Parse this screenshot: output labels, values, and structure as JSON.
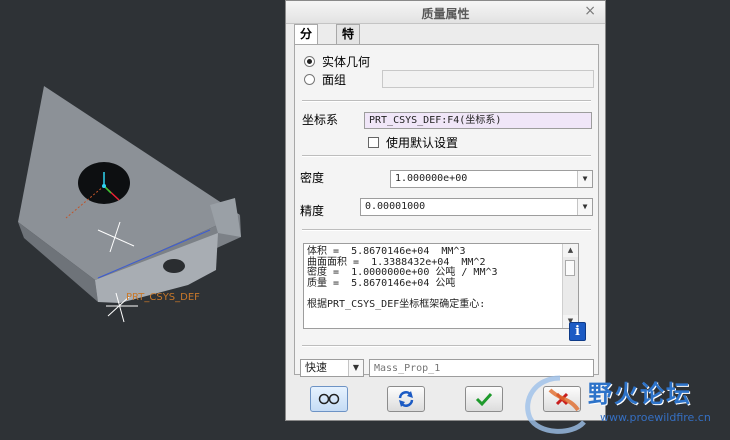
{
  "dialog": {
    "title": "质量属性",
    "close_glyph": "×",
    "tabs": [
      {
        "label": "分析",
        "active": true
      },
      {
        "label": "特征",
        "active": false
      }
    ],
    "geometry": {
      "option_solid": "实体几何",
      "option_quilt": "面组",
      "quilt_value": ""
    },
    "csys": {
      "label": "坐标系",
      "value": "PRT_CSYS_DEF:F4(坐标系)",
      "use_default_label": "使用默认设置",
      "use_default_checked": false
    },
    "density": {
      "label": "密度",
      "value": "1.000000e+00"
    },
    "precision": {
      "label": "精度",
      "value": "0.00001000"
    },
    "results": {
      "lines": [
        "体积 =  5.8670146e+04  MM^3",
        "曲面面积 =  1.3388432e+04  MM^2",
        "密度 =  1.0000000e+00 公吨 / MM^3",
        "质量 =  5.8670146e+04 公吨",
        "",
        "根据PRT_CSYS_DEF坐标框架确定重心:"
      ]
    },
    "mode": {
      "value": "快速",
      "name_placeholder": "Mass_Prop_1"
    },
    "info_glyph": "i"
  },
  "viewport": {
    "csys_label": "PRT_CSYS_DEF"
  },
  "watermark": {
    "text": "野火论坛",
    "url": "www.proewildfire.cn"
  },
  "colors": {
    "background": "#2e3236",
    "accent": "#1c5bc4",
    "ok_green": "#1e9a2c",
    "cancel_red": "#c81e1e"
  }
}
